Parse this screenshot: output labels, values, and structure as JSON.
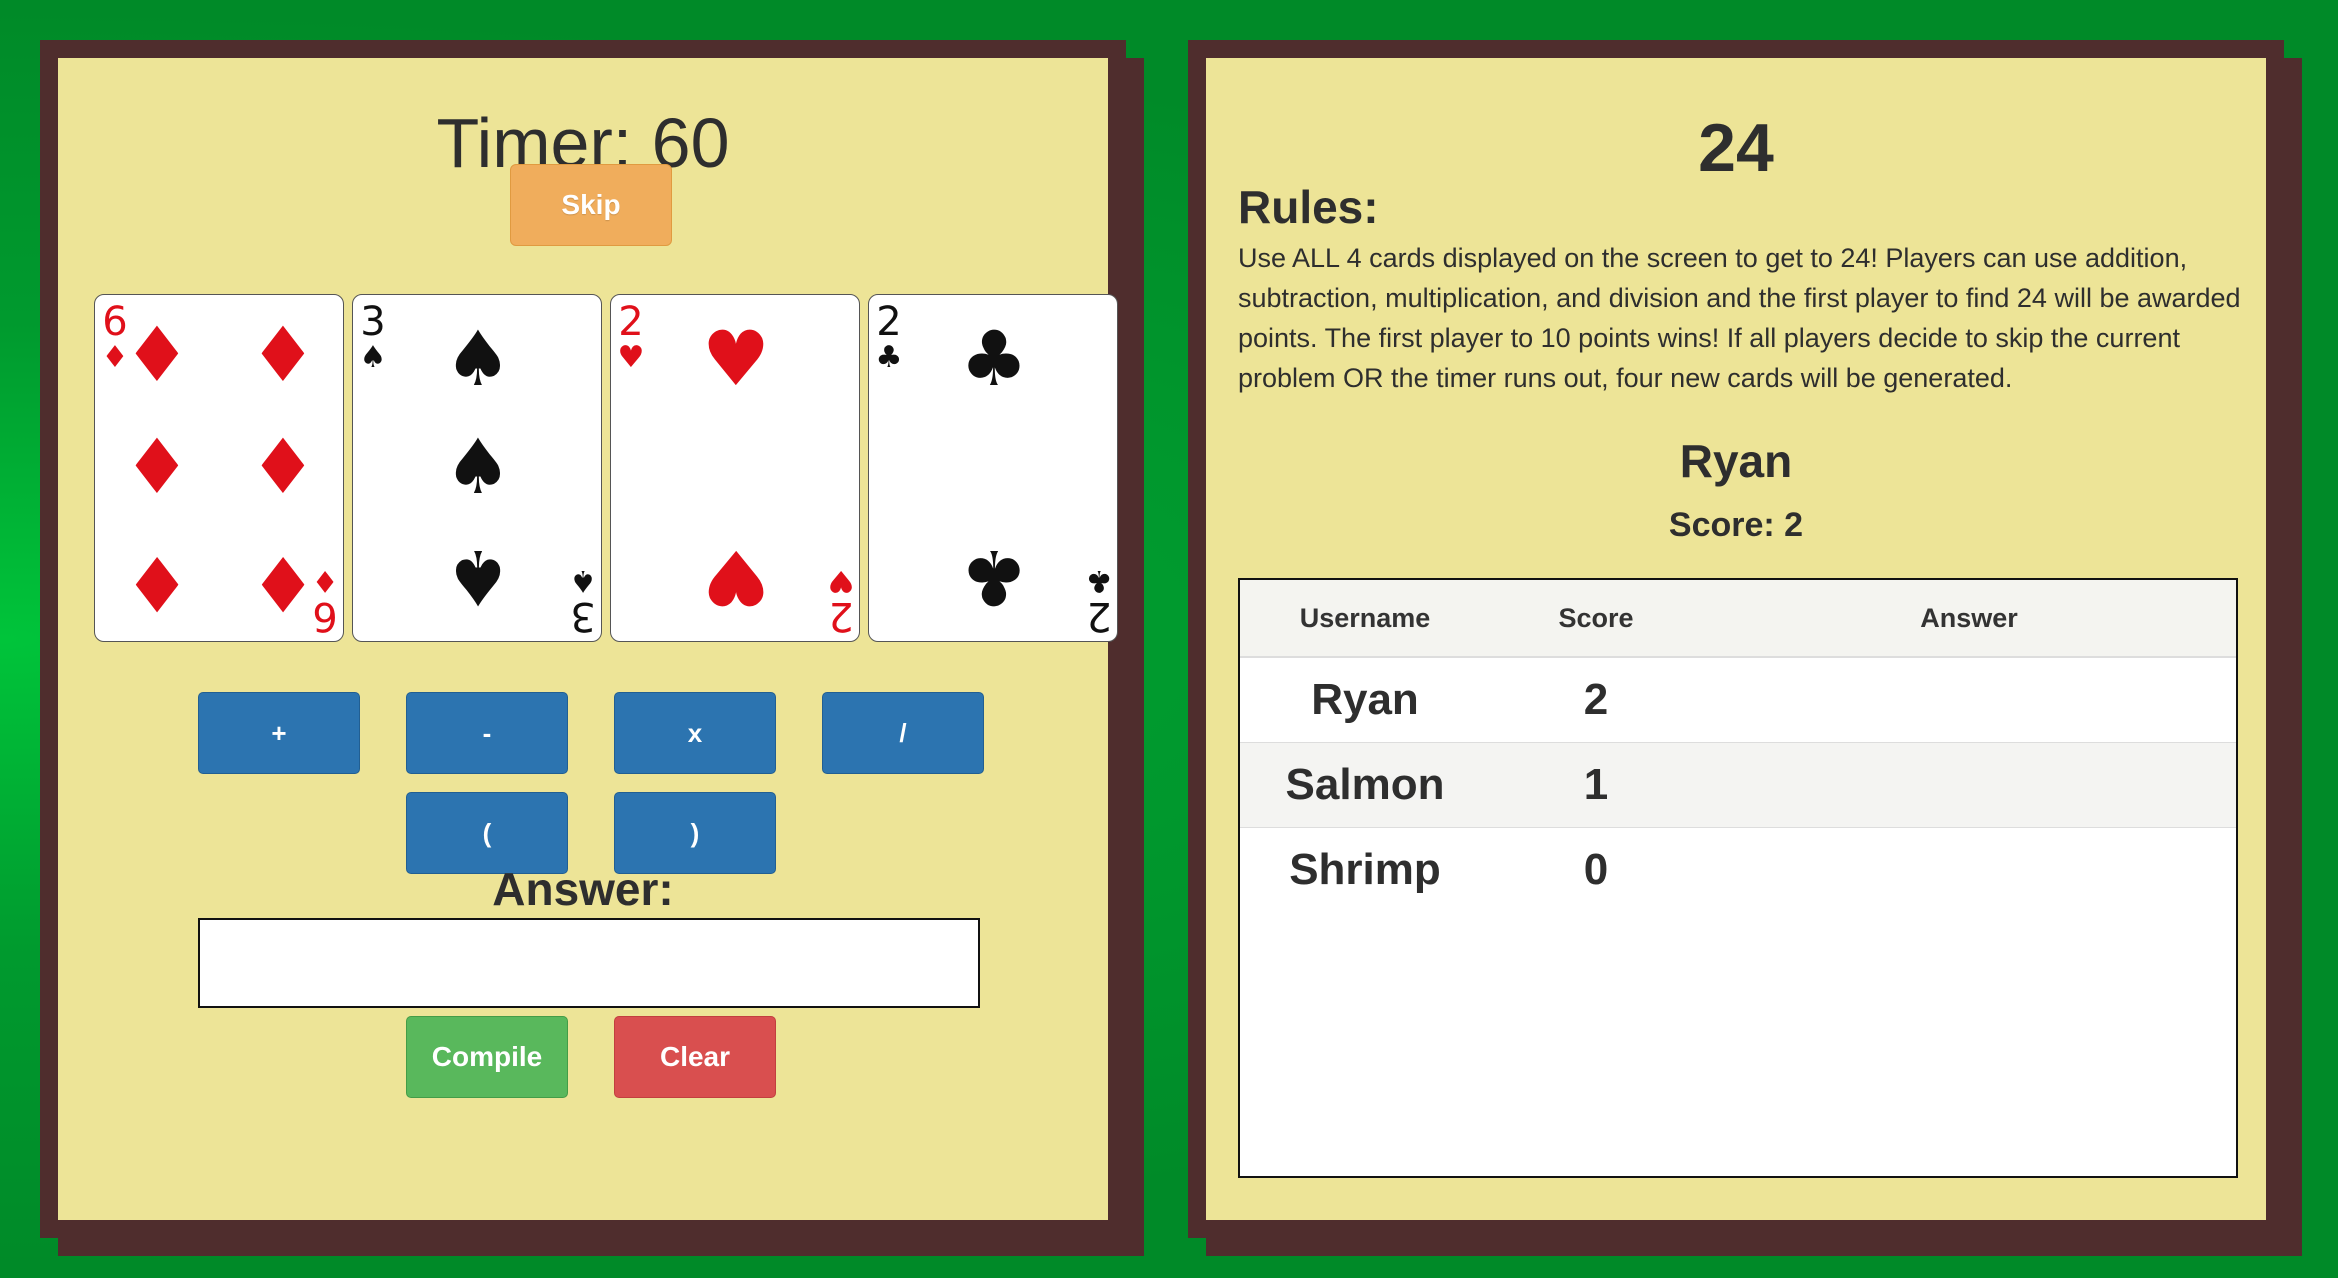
{
  "timer": {
    "text": "Timer: 60"
  },
  "skip_label": "Skip",
  "cards": [
    {
      "rank": "6",
      "suit": "diamonds",
      "color": "#e0101a"
    },
    {
      "rank": "3",
      "suit": "spades",
      "color": "#111111"
    },
    {
      "rank": "2",
      "suit": "hearts",
      "color": "#e0101a"
    },
    {
      "rank": "2",
      "suit": "clubs",
      "color": "#111111"
    }
  ],
  "operators": [
    "+",
    "-",
    "x",
    "/",
    "(",
    ")"
  ],
  "answer": {
    "label": "Answer:",
    "value": ""
  },
  "compile_label": "Compile",
  "clear_label": "Clear",
  "game_title": "24",
  "rules": {
    "heading": "Rules:",
    "text": "Use ALL 4 cards displayed on the screen to get to 24! Players can use addition, subtraction, multiplication, and division and the first player to find 24 will be awarded points. The first player to 10 points wins! If all players decide to skip the current problem OR the timer runs out, four new cards will be generated."
  },
  "player": {
    "name": "Ryan",
    "score_text": "Score: 2"
  },
  "table": {
    "headers": [
      "Username",
      "Score",
      "Answer"
    ],
    "rows": [
      {
        "username": "Ryan",
        "score": "2",
        "answer": ""
      },
      {
        "username": "Salmon",
        "score": "1",
        "answer": ""
      },
      {
        "username": "Shrimp",
        "score": "0",
        "answer": ""
      }
    ]
  },
  "colors": {
    "background": "#008a28",
    "panel": "#ede497",
    "frame": "#4f2d2d",
    "skip": "#f0ad5c",
    "operator": "#2c74b0",
    "compile": "#59b85c",
    "clear": "#d94f4f"
  }
}
